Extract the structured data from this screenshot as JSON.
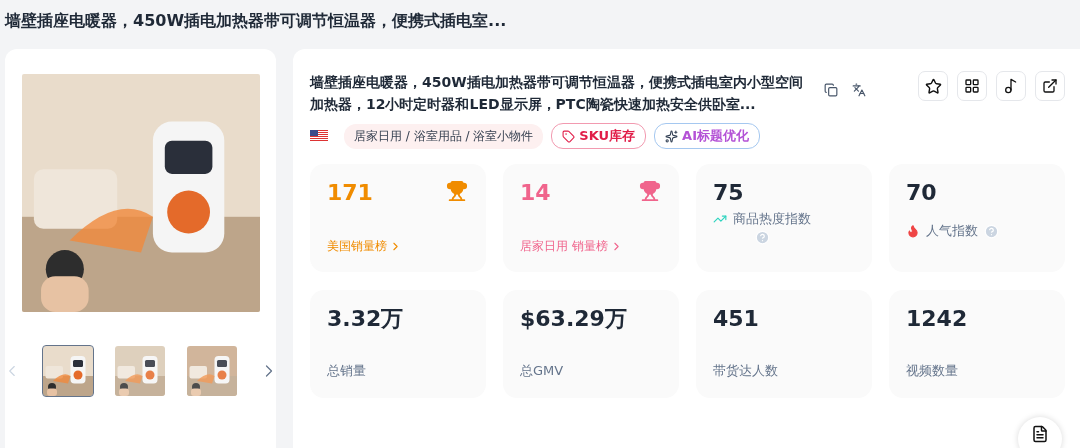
{
  "page_title": "墙壁插座电暖器，450W插电加热器带可调节恒温器，便携式插电室...",
  "gallery": {
    "thumbnails": [
      {
        "selected": true
      },
      {
        "selected": false
      },
      {
        "selected": false
      }
    ]
  },
  "product": {
    "title": "墙壁插座电暖器，450W插电加热器带可调节恒温器，便携式插电室内小型空间加热器，12小时定时器和LED显示屏，PTC陶瓷快速加热安全供卧室...",
    "category": "居家日用 / 浴室用品 / 浴室小物件",
    "sku_button": "SKU库存",
    "ai_button": "AI标题优化"
  },
  "stats": [
    {
      "kind": "rank",
      "value": "171",
      "label": "美国销量榜",
      "color": "#f08c00"
    },
    {
      "kind": "rank",
      "value": "14",
      "label": "居家日用 销量榜",
      "color": "#f0648c"
    },
    {
      "kind": "trend",
      "value": "75",
      "label": "商品热度指数"
    },
    {
      "kind": "hot",
      "value": "70",
      "label": "人气指数"
    },
    {
      "kind": "plain",
      "value": "3.32万",
      "label": "总销量"
    },
    {
      "kind": "plain",
      "value": "$63.29万",
      "label": "总GMV"
    },
    {
      "kind": "plain",
      "value": "451",
      "label": "带货达人数"
    },
    {
      "kind": "plain",
      "value": "1242",
      "label": "视频数量"
    }
  ]
}
